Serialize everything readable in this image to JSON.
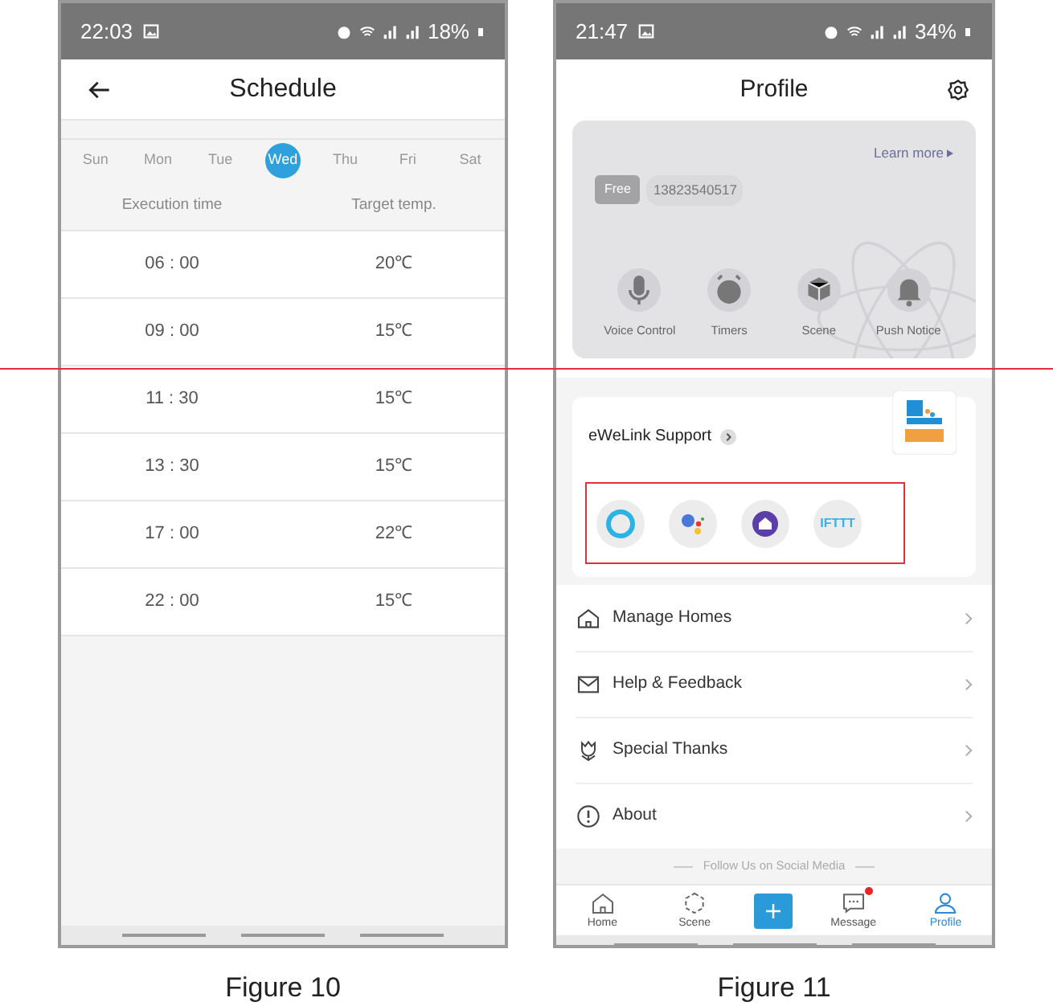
{
  "schedule_screen": {
    "caption": "Figure 10",
    "status_bar": {
      "time": "22:03",
      "battery": "18%"
    },
    "header": {
      "title": "Schedule"
    },
    "days": [
      {
        "label": "Sun",
        "selected": false
      },
      {
        "label": "Mon",
        "selected": false
      },
      {
        "label": "Tue",
        "selected": false
      },
      {
        "label": "Wed",
        "selected": true
      },
      {
        "label": "Thu",
        "selected": false
      },
      {
        "label": "Fri",
        "selected": false
      },
      {
        "label": "Sat",
        "selected": false
      }
    ],
    "columns": [
      "Execution time",
      "Target temp."
    ],
    "rows": [
      {
        "time": "06 : 00",
        "temp": "20℃"
      },
      {
        "time": "09 : 00",
        "temp": "15℃"
      },
      {
        "time": "11 : 30",
        "temp": "15℃"
      },
      {
        "time": "13 : 30",
        "temp": "15℃"
      },
      {
        "time": "17 : 00",
        "temp": "22℃"
      },
      {
        "time": "22 : 00",
        "temp": "15℃"
      }
    ]
  },
  "profile_screen": {
    "caption": "Figure 11",
    "status_bar": {
      "time": "21:47",
      "battery": "34%"
    },
    "header": {
      "title": "Profile"
    },
    "account_card": {
      "learn_more": "Learn more",
      "plan": "Free",
      "phone": "13823540517",
      "actions": [
        {
          "kind": "mic",
          "label": "Voice Control"
        },
        {
          "kind": "timer",
          "label": "Timers"
        },
        {
          "kind": "scene",
          "label": "Scene"
        },
        {
          "kind": "bell",
          "label": "Push Notice"
        }
      ]
    },
    "support_card": {
      "title": "eWeLink Support",
      "integrations": [
        {
          "kind": "alexa"
        },
        {
          "kind": "google"
        },
        {
          "kind": "smartthings"
        },
        {
          "kind": "ifttt",
          "label": "IFTTT"
        }
      ]
    },
    "menu": [
      {
        "kind": "home",
        "label": "Manage Homes"
      },
      {
        "kind": "mail",
        "label": "Help & Feedback"
      },
      {
        "kind": "flower",
        "label": "Special Thanks"
      },
      {
        "kind": "info",
        "label": "About"
      }
    ],
    "footer": "Follow Us on Social Media",
    "tab_bar": [
      {
        "kind": "home",
        "label": "Home",
        "selected": false,
        "badge": false
      },
      {
        "kind": "scene",
        "label": "Scene",
        "selected": false,
        "badge": false
      },
      {
        "kind": "add",
        "selected": false,
        "badge": false
      },
      {
        "kind": "message",
        "label": "Message",
        "selected": false,
        "badge": true
      },
      {
        "kind": "profile",
        "label": "Profile",
        "selected": true,
        "badge": false
      }
    ]
  }
}
